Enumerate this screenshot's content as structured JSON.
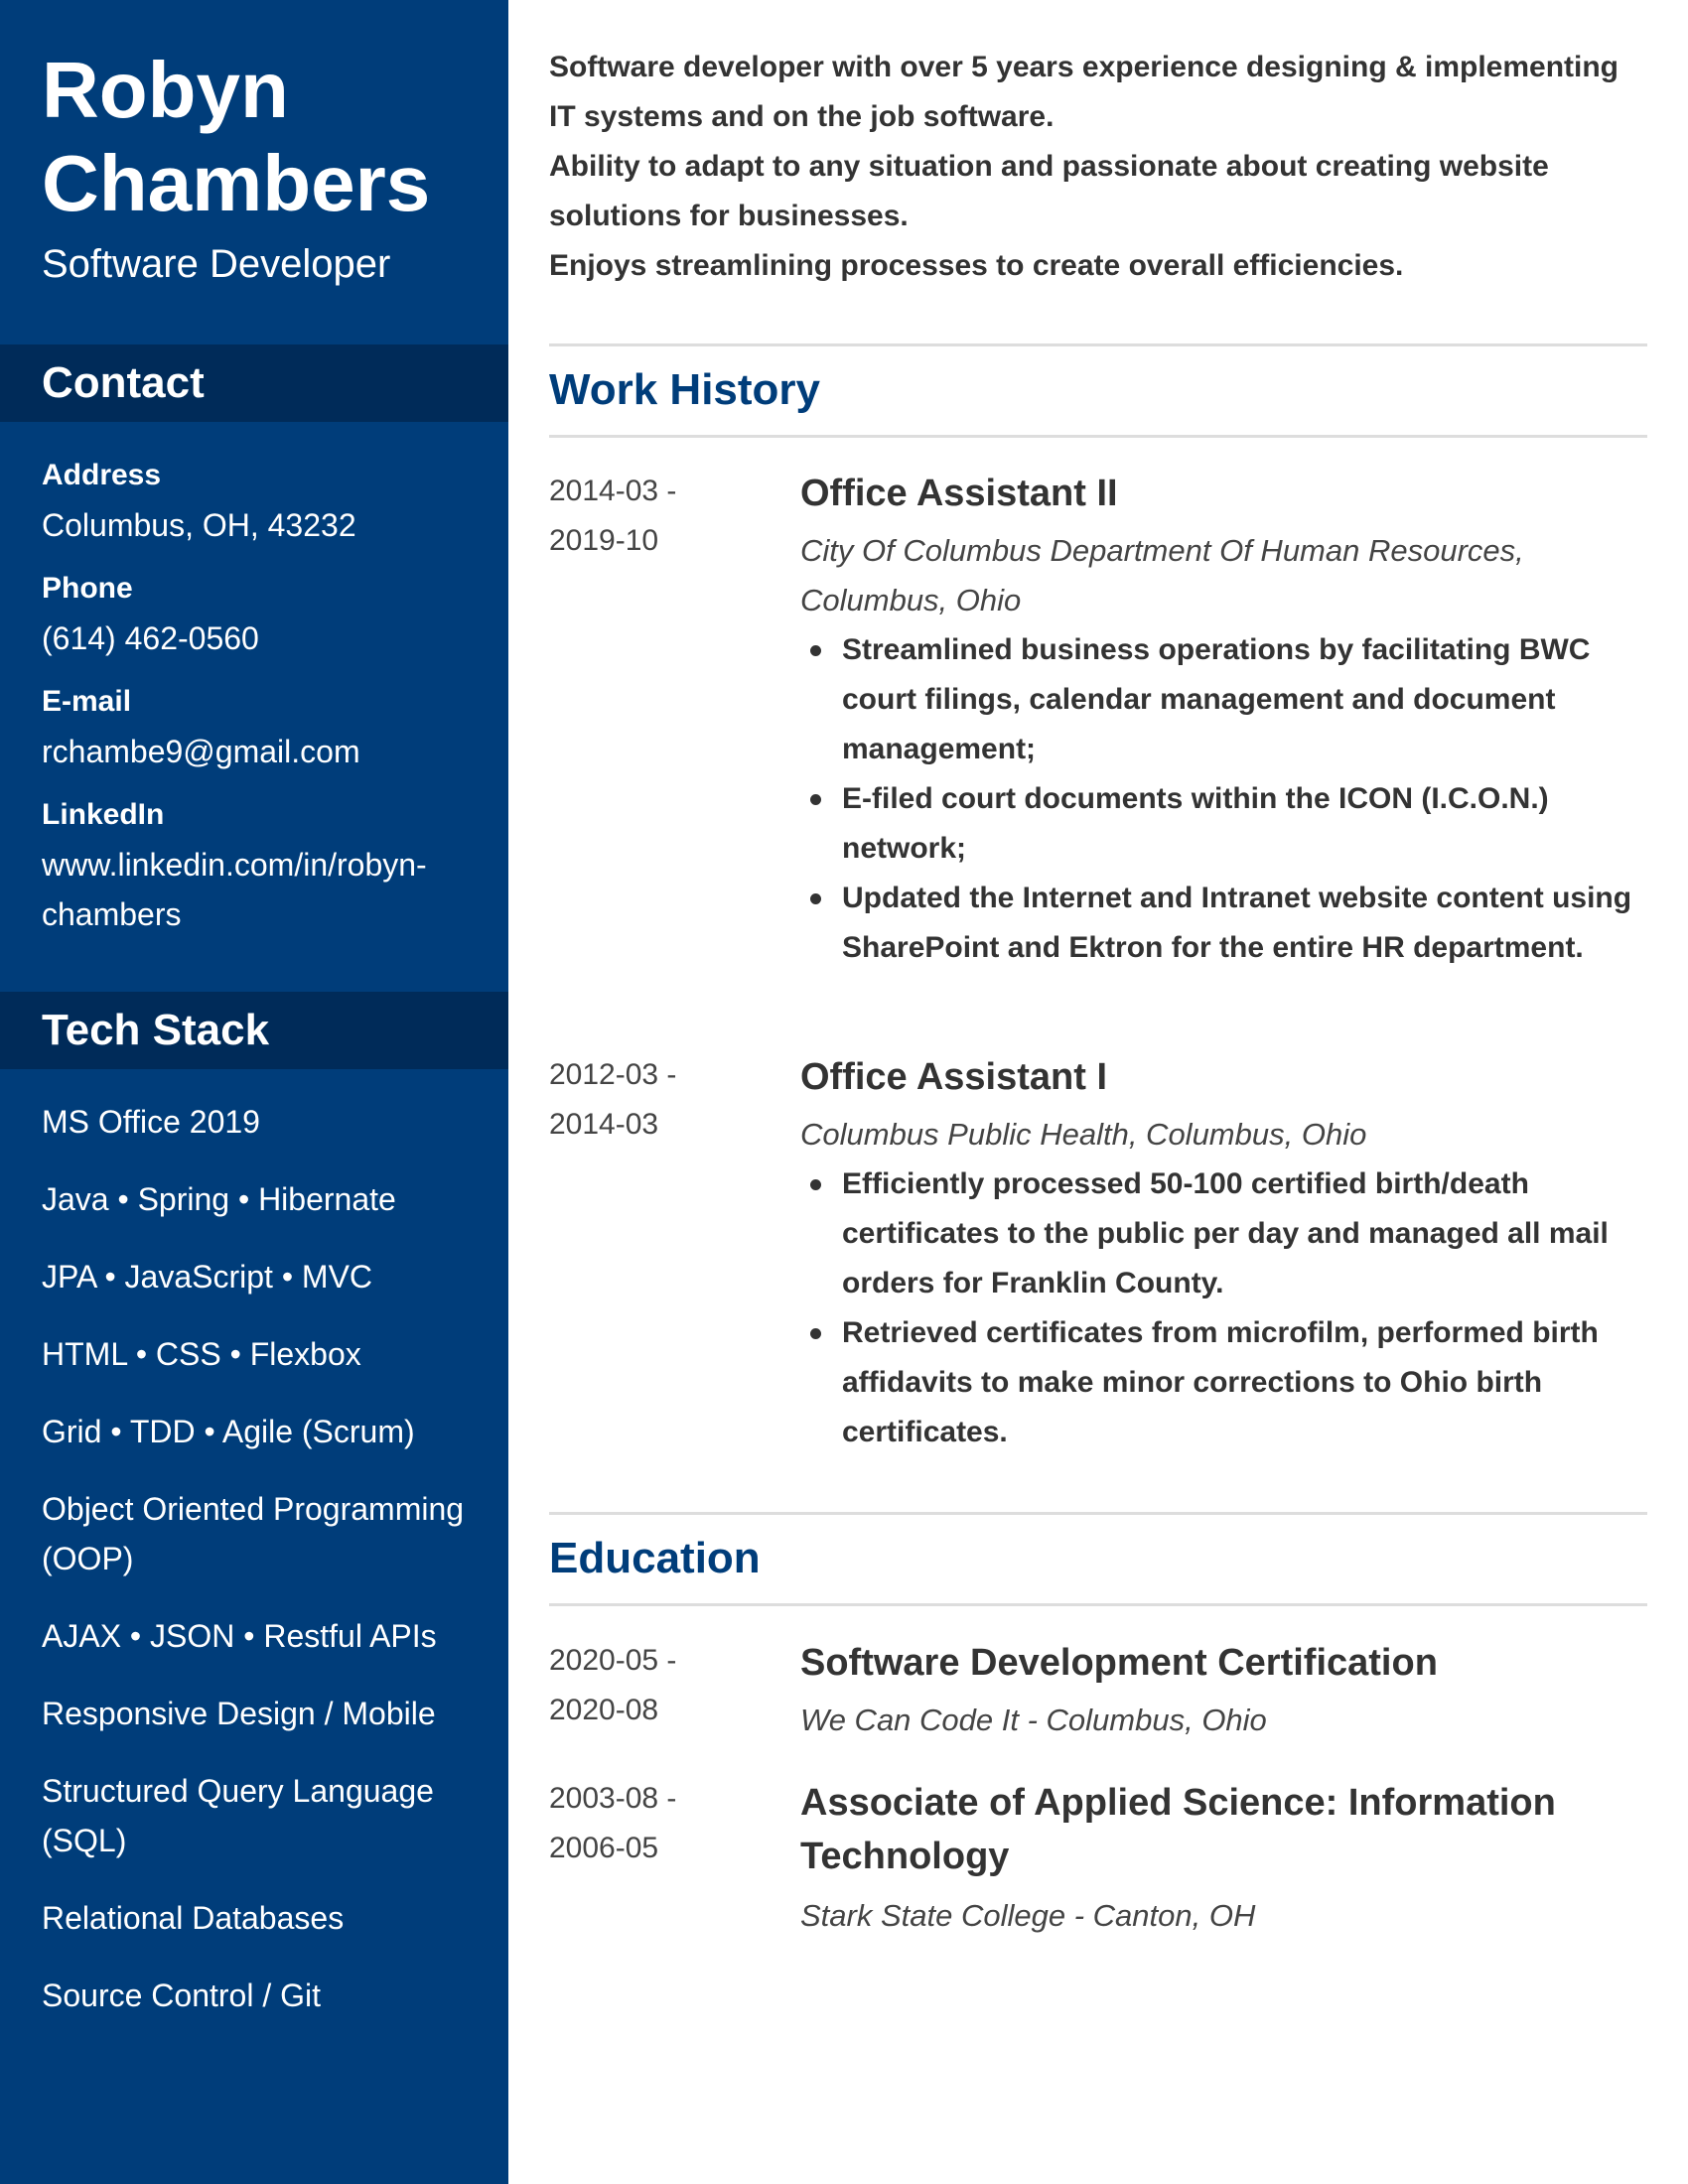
{
  "profile": {
    "first_name": "Robyn",
    "last_name": "Chambers",
    "role": "Software Developer"
  },
  "contact": {
    "heading": "Contact",
    "items": [
      {
        "label": "Address",
        "value": "Columbus, OH, 43232"
      },
      {
        "label": "Phone",
        "value": "(614) 462-0560"
      },
      {
        "label": "E-mail",
        "value": "rchambe9@gmail.com"
      },
      {
        "label": "LinkedIn",
        "value": "www.linkedin.com/in/robyn-chambers"
      }
    ]
  },
  "tech_stack": {
    "heading": "Tech Stack",
    "items": [
      "MS Office 2019",
      "Java • Spring • Hibernate",
      "JPA • JavaScript • MVC",
      "HTML • CSS • Flexbox",
      "Grid • TDD • Agile (Scrum)",
      "Object Oriented Programming (OOP)",
      "AJAX • JSON • Restful APIs",
      "Responsive Design / Mobile",
      "Structured Query Language (SQL)",
      "Relational Databases",
      "Source Control / Git"
    ]
  },
  "summary": [
    "Software developer with over 5 years experience designing & implementing IT systems and on the job software.",
    "Ability to adapt to any situation and passionate about creating website solutions for businesses.",
    "Enjoys streamlining processes to create overall efficiencies."
  ],
  "work_history": {
    "heading": "Work History",
    "jobs": [
      {
        "start": "2014-03 -",
        "end": "2019-10",
        "title": "Office Assistant II",
        "org": "City Of Columbus Department Of Human Resources, Columbus, Ohio",
        "bullets": [
          "Streamlined business operations by facilitating BWC court filings, calendar management and document management;",
          "E-filed court documents within the ICON (I.C.O.N.) network;",
          "Updated the Internet and Intranet website content using SharePoint and Ektron for the entire HR department."
        ]
      },
      {
        "start": "2012-03 -",
        "end": "2014-03",
        "title": "Office Assistant I",
        "org": "Columbus Public Health, Columbus, Ohio",
        "bullets": [
          "Efficiently processed 50-100 certified birth/death certificates to the public per day and managed all mail orders for Franklin County.",
          "Retrieved certificates from microfilm, performed birth affidavits to make minor corrections to Ohio birth certificates."
        ]
      }
    ]
  },
  "education": {
    "heading": "Education",
    "entries": [
      {
        "start": "2020-05 -",
        "end": "2020-08",
        "title": "Software Development Certification",
        "org": "We Can Code It - Columbus, Ohio"
      },
      {
        "start": "2003-08 -",
        "end": "2006-05",
        "title": "Associate of Applied Science: Information Technology",
        "org": "Stark State College - Canton, OH"
      }
    ]
  },
  "colors": {
    "sidebar": "#003d7a",
    "sidebar_heading": "#002b59",
    "section_title": "#003d7a",
    "body_text": "#333333",
    "rule": "#dddddd"
  }
}
